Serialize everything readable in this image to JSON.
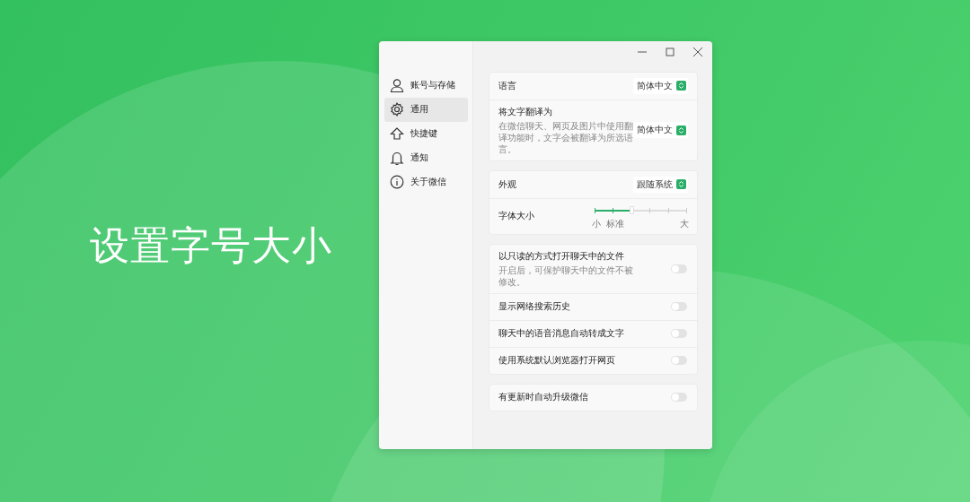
{
  "headline": "设置字号大小",
  "sidebar": {
    "items": [
      {
        "label": "账号与存储",
        "selected": false
      },
      {
        "label": "通用",
        "selected": true
      },
      {
        "label": "快捷键",
        "selected": false
      },
      {
        "label": "通知",
        "selected": false
      },
      {
        "label": "关于微信",
        "selected": false
      }
    ]
  },
  "sections": [
    {
      "rows": [
        {
          "kind": "select",
          "label": "语言",
          "value": "简体中文"
        },
        {
          "kind": "select",
          "label": "将文字翻译为",
          "description": "在微信聊天、网页及图片中使用翻译功能时，文字会被翻译为所选语言。",
          "value": "简体中文"
        }
      ]
    },
    {
      "rows": [
        {
          "kind": "select",
          "label": "外观",
          "value": "跟随系统"
        },
        {
          "kind": "slider",
          "label": "字体大小",
          "level": 0.4,
          "scale": [
            "小",
            "标准",
            "大"
          ]
        }
      ]
    },
    {
      "rows": [
        {
          "kind": "toggle",
          "label": "以只读的方式打开聊天中的文件",
          "description": "开启后，可保护聊天中的文件不被修改。",
          "on": false
        },
        {
          "kind": "toggle",
          "label": "显示网络搜索历史",
          "on": false
        },
        {
          "kind": "toggle",
          "label": "聊天中的语音消息自动转成文字",
          "on": false
        },
        {
          "kind": "toggle",
          "label": "使用系统默认浏览器打开网页",
          "on": false
        }
      ]
    },
    {
      "rows": [
        {
          "kind": "toggle",
          "label": "有更新时自动升级微信",
          "on": false
        }
      ]
    }
  ]
}
